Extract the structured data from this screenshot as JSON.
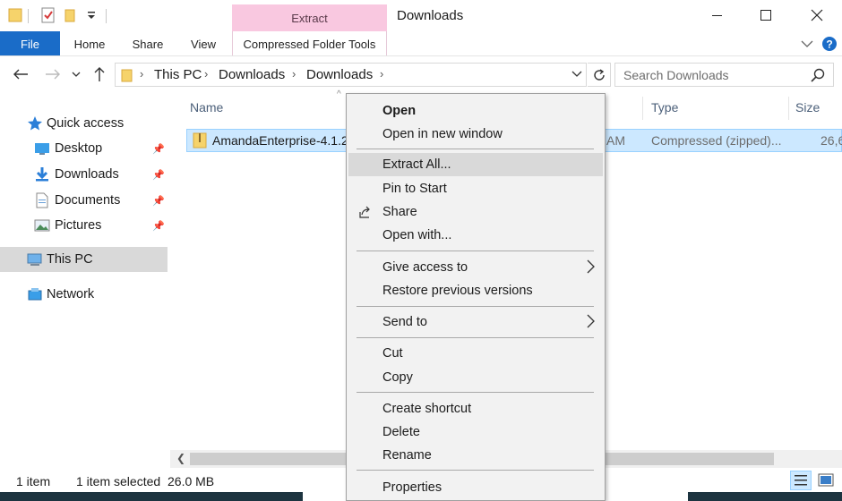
{
  "window": {
    "title": "Downloads",
    "contextual_group": "Extract"
  },
  "ribbon": {
    "tabs": [
      "File",
      "Home",
      "Share",
      "View"
    ],
    "contextual_tab": "Compressed Folder Tools"
  },
  "address": {
    "crumbs": [
      "This PC",
      "Downloads",
      "Downloads"
    ]
  },
  "search": {
    "placeholder": "Search Downloads"
  },
  "nav": {
    "quick_access": "Quick access",
    "items": [
      {
        "label": "Desktop"
      },
      {
        "label": "Downloads"
      },
      {
        "label": "Documents"
      },
      {
        "label": "Pictures"
      }
    ],
    "this_pc": "This PC",
    "network": "Network"
  },
  "columns": {
    "name": "Name",
    "type": "Type",
    "size": "Size"
  },
  "file": {
    "name": "AmandaEnterprise-4.1.2",
    "date_fragment": "AM",
    "type": "Compressed (zipped)...",
    "size": "26,6"
  },
  "context_menu": {
    "open": "Open",
    "open_new_window": "Open in new window",
    "extract_all": "Extract All...",
    "pin_to_start": "Pin to Start",
    "share": "Share",
    "open_with": "Open with...",
    "give_access": "Give access to",
    "restore_versions": "Restore previous versions",
    "send_to": "Send to",
    "cut": "Cut",
    "copy": "Copy",
    "create_shortcut": "Create shortcut",
    "delete": "Delete",
    "rename": "Rename",
    "properties": "Properties"
  },
  "status": {
    "count": "1 item",
    "selected": "1 item selected",
    "size": "26.0 MB"
  },
  "colors": {
    "file_tab": "#1a6cc8",
    "contextual_tab": "#f9c8e0",
    "selection": "#cce8ff",
    "menu_highlight": "#d9d9d9"
  }
}
